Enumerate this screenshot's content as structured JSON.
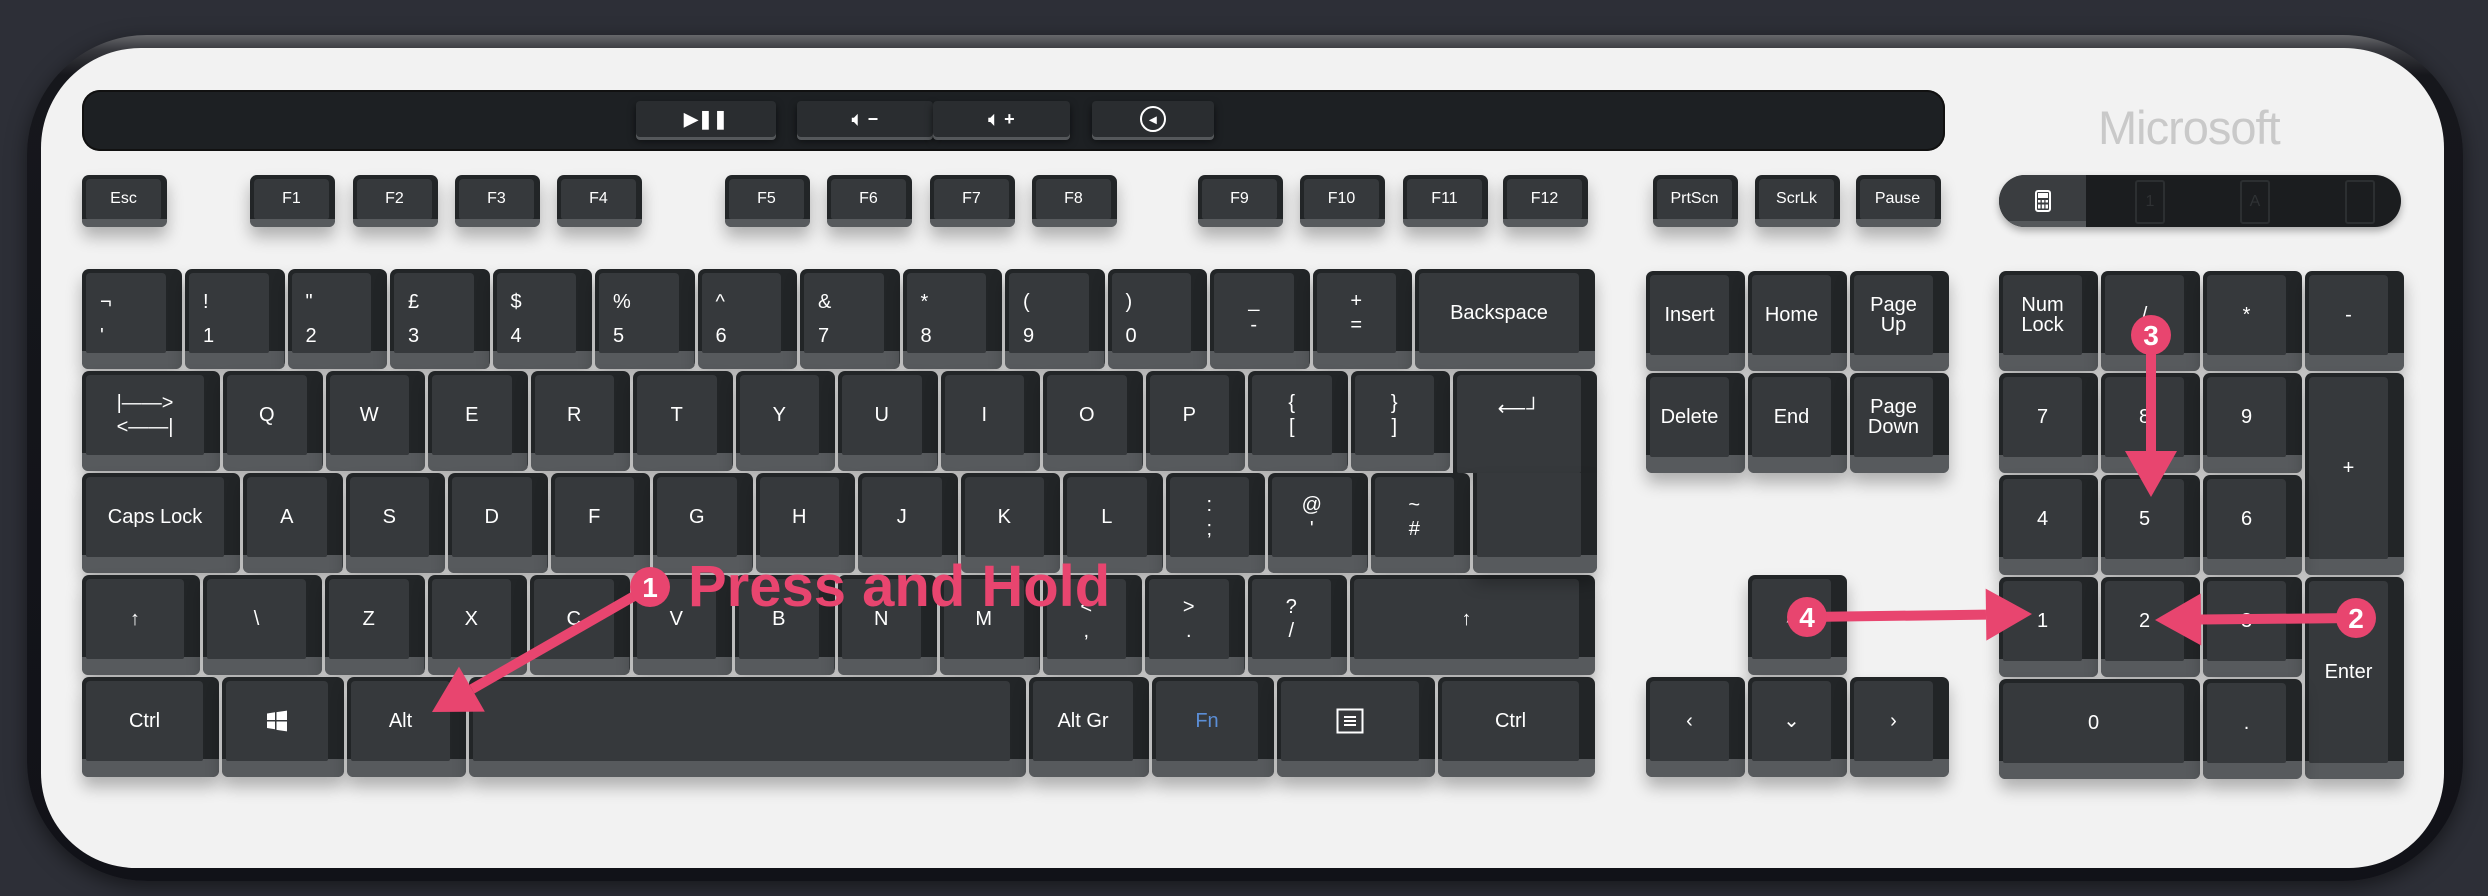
{
  "keyboard": {
    "brand": "Microsoft",
    "media_keys": [
      {
        "icon": "play-pause-icon",
        "label": "▶❚❚"
      },
      {
        "icon": "volume-down-icon",
        "label": "🔈︎ −"
      },
      {
        "icon": "volume-up-icon",
        "label": "🔈︎ +"
      },
      {
        "icon": "mute-circle-icon",
        "label": "◂"
      }
    ],
    "function_row": [
      "Esc",
      "F1",
      "F2",
      "F3",
      "F4",
      "F5",
      "F6",
      "F7",
      "F8",
      "F9",
      "F10",
      "F11",
      "F12",
      "PrtScn",
      "ScrLk",
      "Pause"
    ],
    "indicators": [
      {
        "icon": "calculator-icon"
      },
      {
        "icon": "num-lock-indicator-icon",
        "label": "1"
      },
      {
        "icon": "caps-lock-indicator-icon",
        "label": "A"
      },
      {
        "icon": "scroll-lock-indicator-icon",
        "label": ""
      }
    ],
    "rows": [
      [
        {
          "top": "¬",
          "bottom": "'"
        },
        {
          "top": "!",
          "bottom": "1"
        },
        {
          "top": "\"",
          "bottom": "2"
        },
        {
          "top": "£",
          "bottom": "3"
        },
        {
          "top": "$",
          "bottom": "4"
        },
        {
          "top": "%",
          "bottom": "5"
        },
        {
          "top": "^",
          "bottom": "6"
        },
        {
          "top": "&",
          "bottom": "7"
        },
        {
          "top": "*",
          "bottom": "8"
        },
        {
          "top": "(",
          "bottom": "9"
        },
        {
          "top": ")",
          "bottom": "0"
        },
        {
          "top": "_",
          "bottom": "-"
        },
        {
          "top": "+",
          "bottom": "="
        },
        {
          "label": "Backspace"
        }
      ],
      [
        {
          "top": "|——>",
          "bottom": "<——|"
        },
        {
          "label": "Q"
        },
        {
          "label": "W"
        },
        {
          "label": "E"
        },
        {
          "label": "R"
        },
        {
          "label": "T"
        },
        {
          "label": "Y"
        },
        {
          "label": "U"
        },
        {
          "label": "I"
        },
        {
          "label": "O"
        },
        {
          "label": "P"
        },
        {
          "top": "{",
          "bottom": "["
        },
        {
          "top": "}",
          "bottom": "]"
        },
        {
          "label": "⟵┘",
          "icon": "enter-icon"
        }
      ],
      [
        {
          "label": "Caps Lock"
        },
        {
          "label": "A"
        },
        {
          "label": "S"
        },
        {
          "label": "D"
        },
        {
          "label": "F"
        },
        {
          "label": "G"
        },
        {
          "label": "H"
        },
        {
          "label": "J"
        },
        {
          "label": "K"
        },
        {
          "label": "L"
        },
        {
          "top": ":",
          "bottom": ";"
        },
        {
          "top": "@",
          "bottom": "'"
        },
        {
          "top": "~",
          "bottom": "#"
        }
      ],
      [
        {
          "label": "↑",
          "icon": "shift-icon"
        },
        {
          "label": "\\"
        },
        {
          "label": "Z"
        },
        {
          "label": "X"
        },
        {
          "label": "C"
        },
        {
          "label": "V"
        },
        {
          "label": "B"
        },
        {
          "label": "N"
        },
        {
          "label": "M"
        },
        {
          "top": "<",
          "bottom": ","
        },
        {
          "top": ">",
          "bottom": "."
        },
        {
          "top": "?",
          "bottom": "/"
        },
        {
          "label": "↑",
          "icon": "shift-icon"
        }
      ],
      [
        {
          "label": "Ctrl"
        },
        {
          "icon": "windows-icon"
        },
        {
          "label": "Alt"
        },
        {
          "label": ""
        },
        {
          "label": "Alt Gr"
        },
        {
          "label": "Fn"
        },
        {
          "icon": "menu-icon"
        },
        {
          "label": "Ctrl"
        }
      ]
    ],
    "nav": [
      "Insert",
      "Home",
      "Page Up",
      "Delete",
      "End",
      "Page Down"
    ],
    "arrows": [
      "˄",
      "‹",
      "⌄",
      "›"
    ],
    "numpad": [
      "Num Lock",
      "/",
      "*",
      "-",
      "7",
      "8",
      "9",
      "+",
      "4",
      "5",
      "6",
      "1",
      "2",
      "3",
      "Enter",
      "0",
      "."
    ],
    "fn_color": "#5b8ed6"
  },
  "annotations": {
    "color": "#e8456f",
    "steps": [
      {
        "number": "1",
        "text": "Press and Hold"
      },
      {
        "number": "2"
      },
      {
        "number": "3"
      },
      {
        "number": "4"
      }
    ]
  }
}
